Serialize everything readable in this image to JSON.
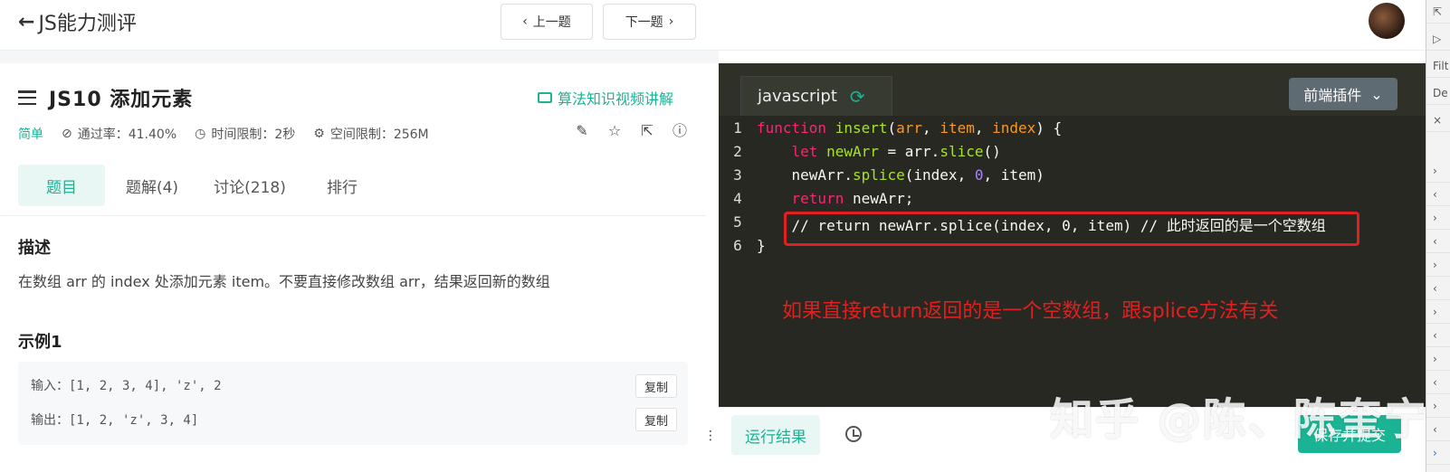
{
  "header": {
    "back_label": "JS能力测评",
    "prev_label": "上一题",
    "next_label": "下一题"
  },
  "problem": {
    "title": "JS10  添加元素",
    "video_link": "算法知识视频讲解",
    "difficulty": "简单",
    "pass_rate": "通过率：41.40%",
    "time_limit": "时间限制：2秒",
    "space_limit": "空间限制：256M",
    "tabs": [
      "题目",
      "题解(4)",
      "讨论(218)",
      "排行"
    ],
    "desc_heading": "描述",
    "description": "在数组 arr 的 index 处添加元素 item。不要直接修改数组 arr，结果返回新的数组",
    "example_heading": "示例1",
    "example": {
      "input_label": "输入：",
      "input_value": "[1, 2, 3, 4], 'z', 2",
      "output_label": "输出：",
      "output_value": "[1, 2, 'z', 3, 4]",
      "copy_label": "复制"
    }
  },
  "editor": {
    "language": "javascript",
    "plugin_label": "前端插件",
    "annotation": "如果直接return返回的是一个空数组，跟splice方法有关",
    "code_lines": [
      "function insert(arr, item, index) {",
      "    let newArr = arr.slice()",
      "    newArr.splice(index, 0, item)",
      "    return newArr;",
      "    // return newArr.splice(index, 0, item) // 此时返回的是一个空数组",
      "}"
    ],
    "line_numbers": [
      "1",
      "2",
      "3",
      "4",
      "5",
      "6"
    ]
  },
  "bottom": {
    "run_result_label": "运行结果",
    "save_submit_label": "保存并提交",
    "watermark": "知乎 @陈、陈奎宁"
  },
  "devtools": {
    "rows": [
      "Filt",
      "De"
    ]
  },
  "colors": {
    "accent": "#1ab394",
    "editor_bg": "#272822",
    "annotation_red": "#e02020"
  }
}
